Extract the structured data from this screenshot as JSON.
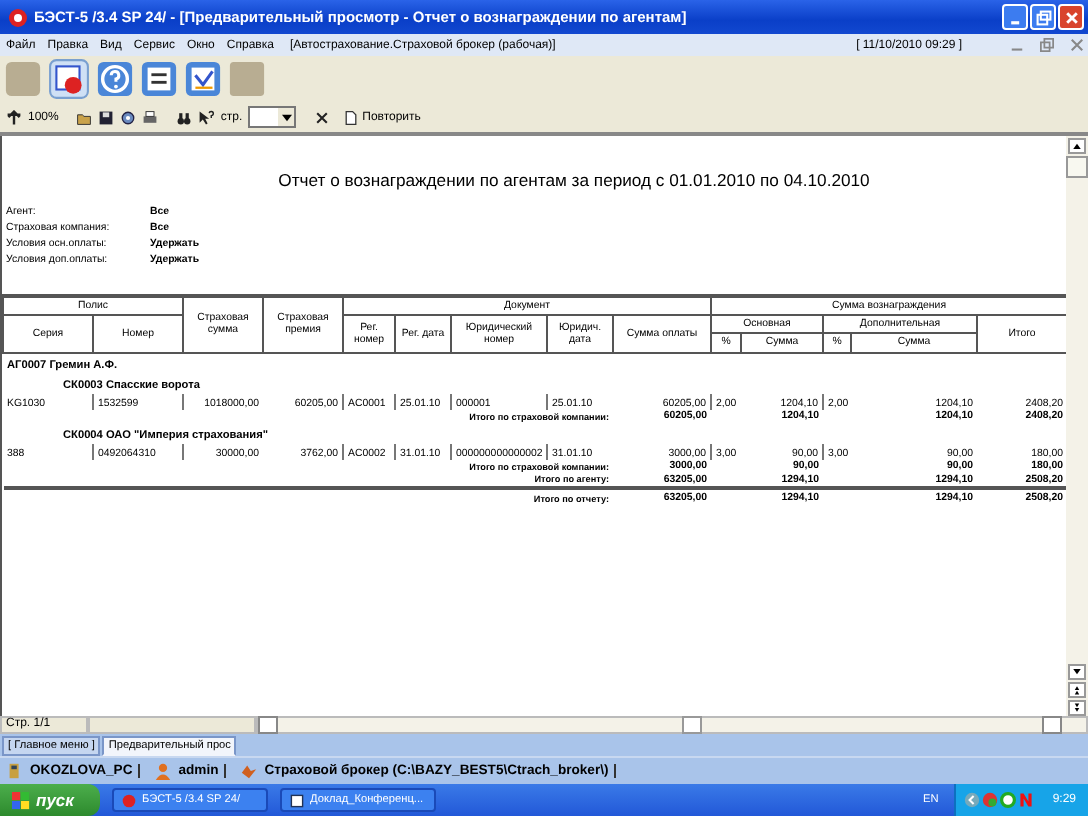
{
  "window": {
    "title": "БЭСТ-5 /3.4 SP 24/ - [Предварительный просмотр - Отчет о вознаграждении по агентам]"
  },
  "menu": {
    "items": [
      "Файл",
      "Правка",
      "Вид",
      "Сервис",
      "Окно",
      "Справка"
    ],
    "context": "[Автострахование.Страховой брокер (рабочая)]",
    "datetime": "[ 11/10/2010 09:29 ]"
  },
  "toolbar": {
    "zoom": "100%",
    "page_label": "стр.",
    "repeat_button": "Повторить"
  },
  "report": {
    "title": "Отчет о вознаграждении по агентам за период с 01.01.2010 по 04.10.2010",
    "params": [
      {
        "label": "Агент:",
        "value": "Все"
      },
      {
        "label": "Страховая компания:",
        "value": "Все"
      },
      {
        "label": "Условия осн.оплаты:",
        "value": "Удержать"
      },
      {
        "label": "Условия доп.оплаты:",
        "value": "Удержать"
      }
    ],
    "columns": [
      {
        "label": "Полис",
        "children": [
          {
            "label": "Серия"
          },
          {
            "label": "Номер"
          }
        ]
      },
      {
        "label": "Страховая сумма"
      },
      {
        "label": "Страховая премия"
      },
      {
        "label": "Документ",
        "children": [
          {
            "label": "Рег. номер"
          },
          {
            "label": "Рег. дата"
          },
          {
            "label": "Юридический номер"
          },
          {
            "label": "Юридич. дата"
          },
          {
            "label": "Сумма оплаты"
          }
        ]
      },
      {
        "label": "Сумма вознаграждения",
        "children": [
          {
            "label": "Основная",
            "children": [
              {
                "label": "%"
              },
              {
                "label": "Сумма"
              }
            ]
          },
          {
            "label": "Дополнительная",
            "children": [
              {
                "label": "%"
              },
              {
                "label": "Сумма"
              }
            ]
          },
          {
            "label": "Итого"
          }
        ]
      }
    ],
    "rows": [
      {
        "kind": "agent",
        "text": "АГ0007 Гремин А.Ф."
      },
      {
        "kind": "company",
        "text": "СК0003 Спасские ворота"
      },
      {
        "kind": "data",
        "cells": [
          "KG1030",
          "1532599",
          "1018000,00",
          "60205,00",
          "AC0001",
          "25.01.10",
          "000001",
          "25.01.10",
          "60205,00",
          "2,00",
          "1204,10",
          "2,00",
          "1204,10",
          "2408,20"
        ]
      },
      {
        "kind": "subtotal",
        "label": "Итого по страховой компании:",
        "values": [
          "60205,00",
          "1204,10",
          "1204,10",
          "2408,20"
        ]
      },
      {
        "kind": "company",
        "text": "СК0004 ОАО \"Империя страхования\""
      },
      {
        "kind": "data",
        "cells": [
          "388",
          "0492064310",
          "30000,00",
          "3762,00",
          "AC0002",
          "31.01.10",
          "000000000000002",
          "31.01.10",
          "3000,00",
          "3,00",
          "90,00",
          "3,00",
          "90,00",
          "180,00"
        ]
      },
      {
        "kind": "subtotal",
        "label": "Итого по страховой компании:",
        "values": [
          "3000,00",
          "90,00",
          "90,00",
          "180,00"
        ]
      },
      {
        "kind": "subtotal",
        "label": "Итого по агенту:",
        "values": [
          "63205,00",
          "1294,10",
          "1294,10",
          "2508,20"
        ]
      },
      {
        "kind": "total",
        "label": "Итого по отчету:",
        "values": [
          "63205,00",
          "1294,10",
          "1294,10",
          "2508,20"
        ]
      }
    ]
  },
  "status": {
    "page": "Стр. 1/1"
  },
  "tabs": [
    {
      "label": "[ Главное меню ]",
      "selected": false
    },
    {
      "label": "Предварительный прос",
      "selected": true
    }
  ],
  "info_bar": {
    "computer": "OKOZLOVA_PC",
    "user": "admin",
    "database": "Страховой брокер (C:\\BAZY_BEST5\\Ctrach_broker\\)"
  },
  "taskbar": {
    "start": "пуск",
    "tasks": [
      {
        "label": "БЭСТ-5 /3.4 SP 24/",
        "selected": false
      },
      {
        "label": "Доклад_Конференц...",
        "selected": false
      }
    ],
    "language": "EN",
    "clock": "9:29"
  }
}
